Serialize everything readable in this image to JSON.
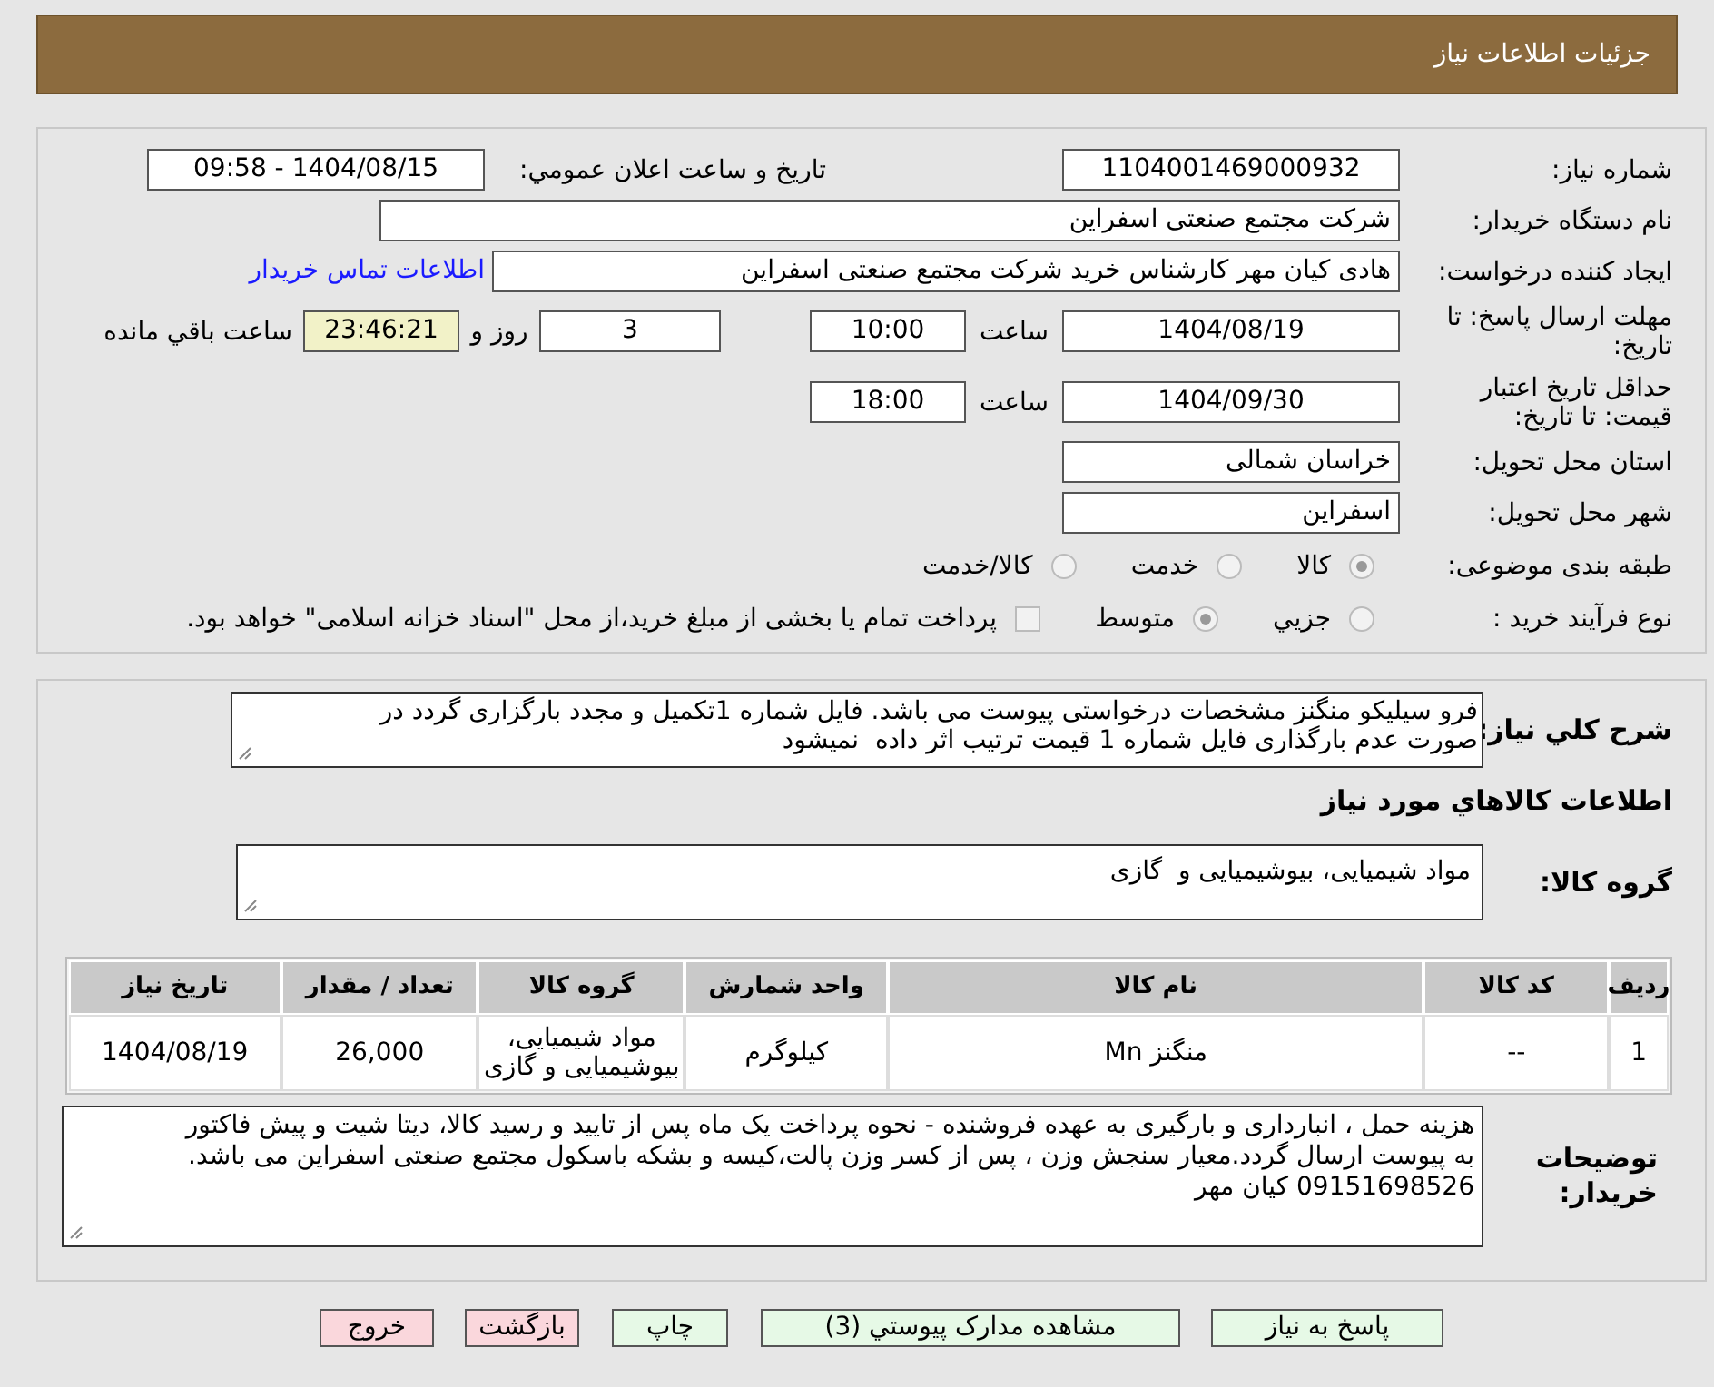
{
  "header": {
    "title": "جزئیات اطلاعات نیاز"
  },
  "need_number": {
    "label": "شماره نیاز:",
    "value": "1104001469000932"
  },
  "announce_date": {
    "label": "تاریخ و ساعت اعلان عمومي:",
    "value": "1404/08/15 - 09:58"
  },
  "buyer_org": {
    "label": "نام دستگاه خريدار:",
    "value": "شرکت مجتمع صنعتی اسفراین"
  },
  "requester": {
    "label": "ايجاد کننده درخواست:",
    "value": "هادی کیان مهر کارشناس خرید شرکت مجتمع صنعتی اسفراین",
    "link": "اطلاعات تماس خريدار"
  },
  "deadline": {
    "label": "مهلت ارسال پاسخ: تا تاريخ:",
    "date": "1404/08/19",
    "time_label": "ساعت",
    "time": "10:00",
    "days": "3",
    "days_label": "روز و",
    "remaining": "23:46:21",
    "remaining_label": "ساعت باقي مانده"
  },
  "validity": {
    "label": "حداقل تاريخ اعتبار قيمت: تا تاريخ:",
    "date": "1404/09/30",
    "time_label": "ساعت",
    "time": "18:00"
  },
  "province": {
    "label": "استان محل تحويل:",
    "value": "خراسان شمالی"
  },
  "city": {
    "label": "شهر محل تحويل:",
    "value": "اسفراین"
  },
  "category": {
    "label": "طبقه بندی موضوعی:",
    "options": [
      {
        "label": "کالا",
        "selected": true
      },
      {
        "label": "خدمت",
        "selected": false
      },
      {
        "label": "کالا/خدمت",
        "selected": false
      }
    ]
  },
  "process": {
    "label": "نوع فرآیند خرید :",
    "options": [
      {
        "label": "جزيي",
        "selected": false
      },
      {
        "label": "متوسط",
        "selected": true
      }
    ],
    "treasury": {
      "checked": false,
      "label": "پرداخت تمام يا بخشی از مبلغ خريد،از محل \"اسناد خزانه اسلامی\" خواهد بود."
    }
  },
  "description": {
    "label": "شرح کلي نياز:",
    "lines": [
      "فرو سیلیکو منگنز مشخصات درخواستی پیوست می باشد. فایل شماره 1تکمیل و مجدد بارگزاری گردد در",
      "صورت عدم بارگذاری فایل شماره 1 قیمت ترتیب اثر داده  نمیشود"
    ]
  },
  "goods_heading": "اطلاعات کالاهاي مورد نياز",
  "goods_group": {
    "label": "گروه کالا:",
    "value": "مواد شیمیایی، بیوشیمیایی و  گازی"
  },
  "table": {
    "columns": [
      "رديف",
      "کد کالا",
      "نام کالا",
      "واحد شمارش",
      "گروه کالا",
      "تعداد / مقدار",
      "تاريخ نياز"
    ],
    "rows": [
      [
        "1",
        "--",
        "منگنز Mn",
        "کیلوگرم",
        "مواد شیمیایی، بیوشیمیایی و گازی",
        "26,000",
        "1404/08/19"
      ]
    ]
  },
  "buyer_notes": {
    "label": "توضيحات خريدار:",
    "lines": [
      "هزینه حمل ، انبارداری و بارگیری به عهده فروشنده - نحوه پرداخت یک ماه پس از تایید و رسید کالا، دیتا شیت و پیش فاکتور",
      "به پیوست ارسال گردد.معیار سنجش وزن ، پس از کسر وزن پالت،کیسه و بشکه باسکول مجتمع صنعتی اسفراین می باشد.",
      "09151698526 کیان مهر"
    ]
  },
  "buttons": [
    {
      "label": "پاسخ به نياز",
      "kind": "primary"
    },
    {
      "label": "مشاهده مدارک پيوستي (3)",
      "kind": "primary"
    },
    {
      "label": "چاپ",
      "kind": "primary"
    },
    {
      "label": "بازگشت",
      "kind": "danger"
    },
    {
      "label": "خروج",
      "kind": "danger"
    }
  ]
}
